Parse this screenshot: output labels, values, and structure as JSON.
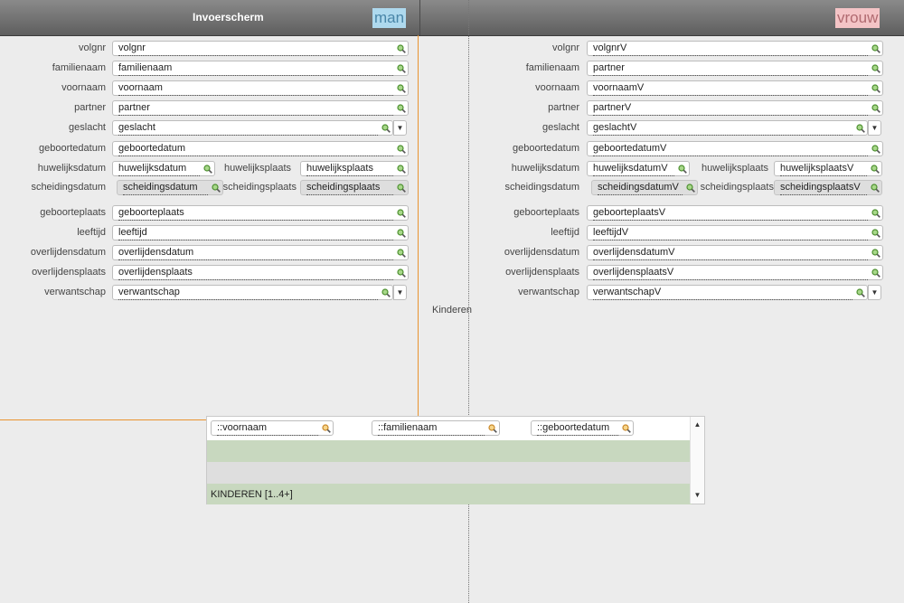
{
  "header": {
    "title": "Invoerscherm",
    "left_badge": "man",
    "right_badge": "vrouw"
  },
  "left": {
    "volgnr_label": "volgnr",
    "volgnr": "volgnr",
    "familienaam_label": "familienaam",
    "familienaam": "familienaam",
    "voornaam_label": "voornaam",
    "voornaam": "voornaam",
    "partner_label": "partner",
    "partner": "partner",
    "geslacht_label": "geslacht",
    "geslacht": "geslacht",
    "geboortedatum_label": "geboortedatum",
    "geboortedatum": "geboortedatum",
    "huwelijksdatum_label": "huwelijksdatum",
    "huwelijksdatum": "huwelijksdatum",
    "huwelijksplaats_label": "huwelijksplaats",
    "huwelijksplaats": "huwelijksplaats",
    "scheidingsdatum_label": "scheidingsdatum",
    "scheidingsdatum": "scheidingsdatum",
    "scheidingsplaats_label": "scheidingsplaats",
    "scheidingsplaats": "scheidingsplaats",
    "geboorteplaats_label": "geboorteplaats",
    "geboorteplaats": "geboorteplaats",
    "leeftijd_label": "leeftijd",
    "leeftijd": "leeftijd",
    "overlijdensdatum_label": "overlijdensdatum",
    "overlijdensdatum": "overlijdensdatum",
    "overlijdensplaats_label": "overlijdensplaats",
    "overlijdensplaats": "overlijdensplaats",
    "verwantschap_label": "verwantschap",
    "verwantschap": "verwantschap"
  },
  "right": {
    "volgnr_label": "volgnr",
    "volgnr": "volgnrV",
    "familienaam_label": "familienaam",
    "familienaam": "partner",
    "voornaam_label": "voornaam",
    "voornaam": "voornaamV",
    "partner_label": "partner",
    "partner": "partnerV",
    "geslacht_label": "geslacht",
    "geslacht": "geslachtV",
    "geboortedatum_label": "geboortedatum",
    "geboortedatum": "geboortedatumV",
    "huwelijksdatum_label": "huwelijksdatum",
    "huwelijksdatum": "huwelijksdatumV",
    "huwelijksplaats_label": "huwelijksplaats",
    "huwelijksplaats": "huwelijksplaatsV",
    "scheidingsdatum_label": "scheidingsdatum",
    "scheidingsdatum": "scheidingsdatumV",
    "scheidingsplaats_label": "scheidingsplaats",
    "scheidingsplaats": "scheidingsplaatsV",
    "geboorteplaats_label": "geboorteplaats",
    "geboorteplaats": "geboorteplaatsV",
    "leeftijd_label": "leeftijd",
    "leeftijd": "leeftijdV",
    "overlijdensdatum_label": "overlijdensdatum",
    "overlijdensdatum": "overlijdensdatumV",
    "overlijdensplaats_label": "overlijdensplaats",
    "overlijdensplaats": "overlijdensplaatsV",
    "verwantschap_label": "verwantschap",
    "verwantschap": "verwantschapV"
  },
  "kinderen_label": "Kinderen",
  "portal": {
    "fields": [
      "::voornaam",
      "::familienaam",
      "::geboortedatum"
    ],
    "row_label": "KINDEREN [1..4+]"
  },
  "icons": {
    "field_search": "green-magnifier-icon",
    "portal_search": "orange-magnifier-icon",
    "dropdown": "triangle-down-icon"
  },
  "colors": {
    "man_badge": "#aed9ee",
    "vrouw_badge": "#f4c4c6",
    "layout_outline": "#e9932f",
    "portal_row": "#c8d8bf"
  }
}
